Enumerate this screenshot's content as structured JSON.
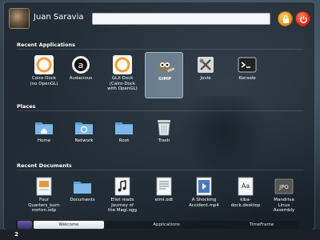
{
  "user": {
    "name": "Juan Saravia"
  },
  "search": {
    "value": ""
  },
  "header_buttons": {
    "lock_icon": "lock-icon",
    "power_icon": "power-icon"
  },
  "sections": {
    "recent_applications": "Recent Applications",
    "places": "Places",
    "recent_documents": "Recent Documents"
  },
  "recent_applications": [
    {
      "label": "Cairo-Dock\n(no OpenGL)",
      "icon": "cairo-dock-icon"
    },
    {
      "label": "Audacious",
      "icon": "audacious-icon"
    },
    {
      "label": "GLX-Dock\n(Cairo-Dock\nwith OpenGL)",
      "icon": "glx-dock-icon"
    },
    {
      "label": "GIMP",
      "icon": "gimp-icon",
      "selected": true
    },
    {
      "label": "Jovie",
      "icon": "jovie-icon"
    },
    {
      "label": "Konsole",
      "icon": "konsole-icon"
    }
  ],
  "places": [
    {
      "label": "Home",
      "icon": "home-folder-icon"
    },
    {
      "label": "Network",
      "icon": "network-folder-icon"
    },
    {
      "label": "Root",
      "icon": "root-folder-icon"
    },
    {
      "label": "Trash",
      "icon": "trash-icon"
    }
  ],
  "recent_documents": [
    {
      "label": "Four\nQuarters_burn\nnorton.odp",
      "icon": "presentation-icon"
    },
    {
      "label": "Documents",
      "icon": "documents-folder-icon"
    },
    {
      "label": "Eliot reads\nJourney of\nthe Magi.ogg",
      "icon": "audio-file-icon"
    },
    {
      "label": "eimi.odt",
      "icon": "text-document-icon"
    },
    {
      "label": "A Shocking\nAccident.mp4",
      "icon": "video-file-icon"
    },
    {
      "label": "kiba-\ndock.desktop",
      "icon": "desktop-file-icon"
    },
    {
      "label": "Mandriva\nLinux\nAssembly",
      "icon": "jpg-image-icon"
    }
  ],
  "tabs": [
    {
      "label": "Welcome",
      "active": true
    },
    {
      "label": "Applications",
      "active": false
    },
    {
      "label": "TimeFrame",
      "active": false
    }
  ],
  "taskbar": {
    "workspace": "2"
  },
  "colors": {
    "selection": "#9fb8d2",
    "folder": "#5b9bd5",
    "power": "#e0341a",
    "lock": "#f29a1c"
  }
}
